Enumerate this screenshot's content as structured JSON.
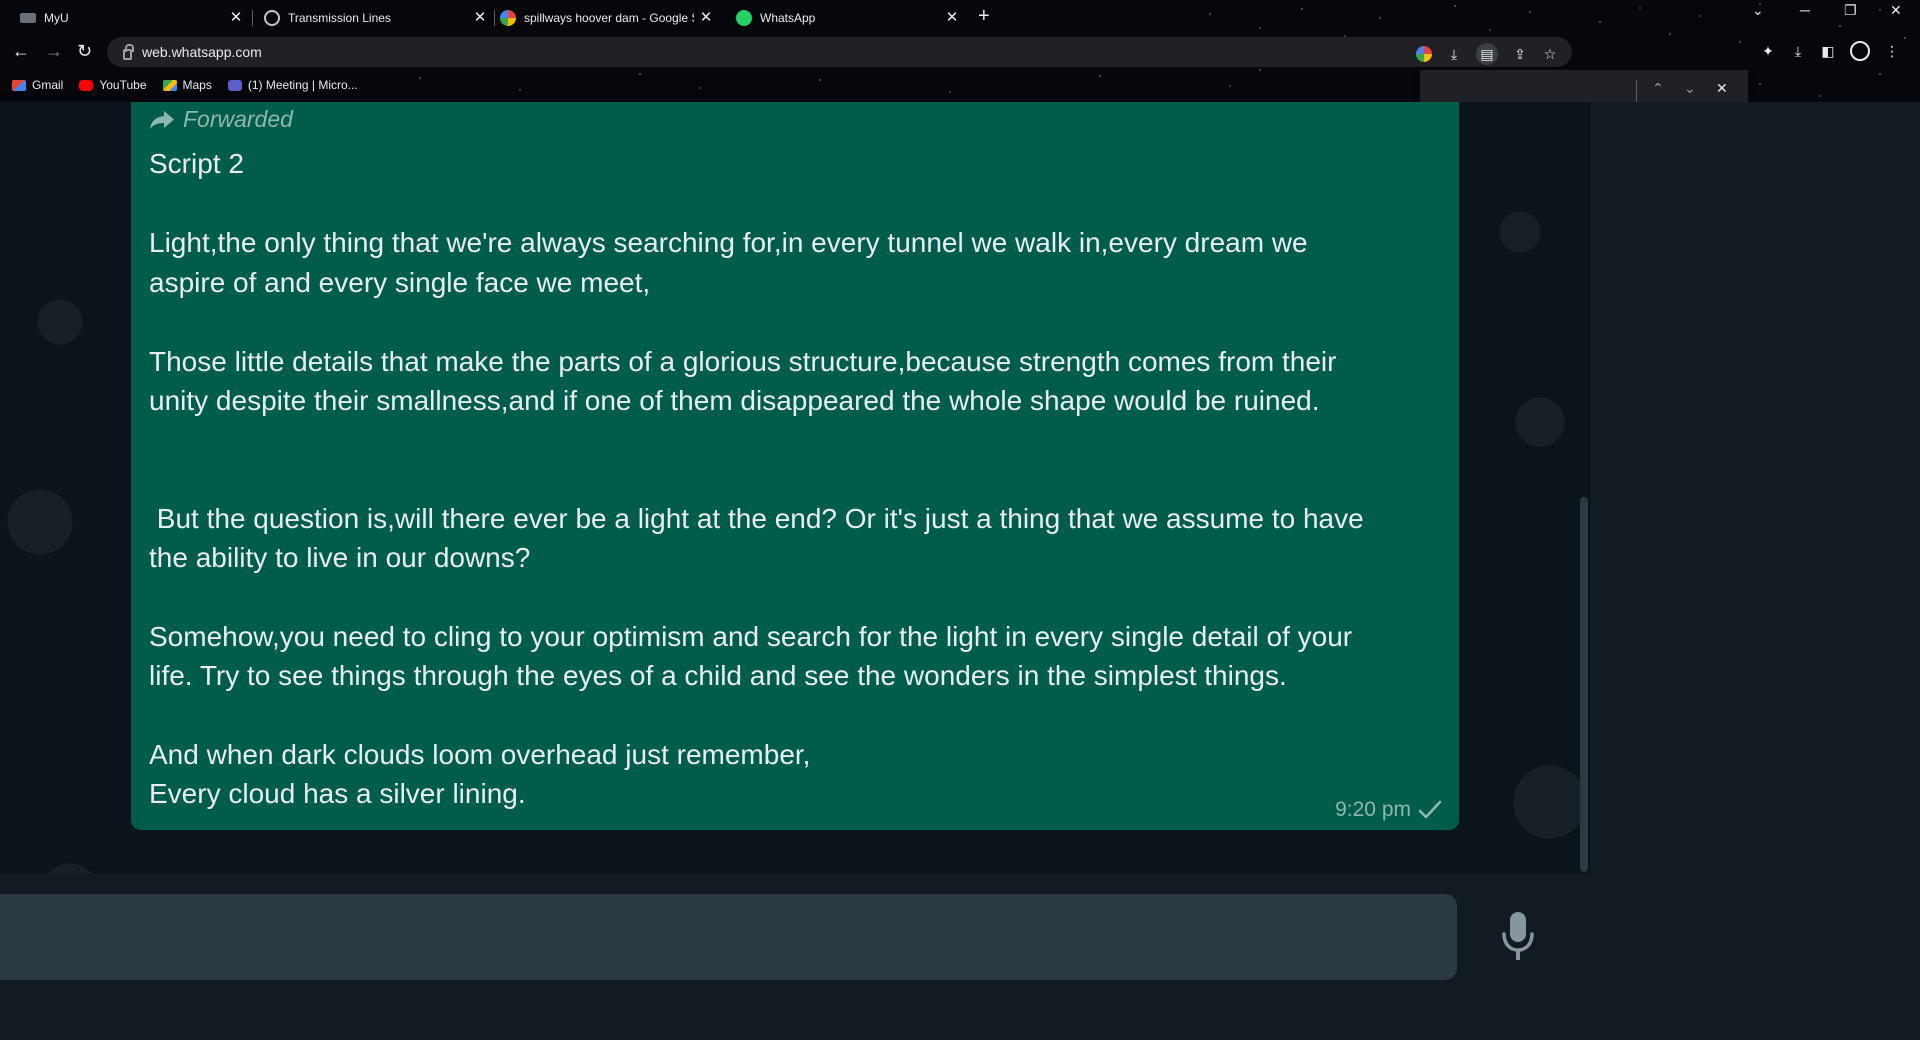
{
  "browser": {
    "tabs": [
      {
        "title": "MyU",
        "icon": "myu-favicon"
      },
      {
        "title": "Transmission Lines",
        "icon": "globe-favicon"
      },
      {
        "title": "spillways hoover dam - Google S",
        "icon": "google-favicon"
      },
      {
        "title": "WhatsApp",
        "icon": "whatsapp-favicon"
      }
    ],
    "new_tab_label": "+",
    "url": "web.whatsapp.com",
    "bookmarks": [
      {
        "label": "Gmail",
        "icon": "gmail-icon"
      },
      {
        "label": "YouTube",
        "icon": "youtube-icon"
      },
      {
        "label": "Maps",
        "icon": "maps-icon"
      },
      {
        "label": "(1) Meeting | Micro...",
        "icon": "teams-icon"
      }
    ]
  },
  "message": {
    "forwarded_label": "Forwarded",
    "lines": [
      "Script 2",
      "Light,the only thing that we're always searching for,in every tunnel we walk in,every dream we",
      "aspire of and every single face we meet,",
      "Those little details that make the parts of a glorious structure,because strength comes from their",
      "unity despite their smallness,and if one of them disappeared the whole shape would be ruined.",
      " But the question is,will there ever be a light at the end? Or it's just a thing that we assume to have",
      "the ability to live in our downs?",
      "Somehow,you need to cling to your optimism and search for the light in every single detail of your",
      "life. Try to see things through the eyes of a child and see the wonders in the simplest things.",
      "And when dark clouds loom overhead just remember,",
      "Every cloud has a silver lining."
    ],
    "time": "9:20 pm",
    "status_icon": "single-check-icon"
  },
  "colors": {
    "outgoing_bubble": "#005c4b",
    "chat_background": "#0b141a",
    "panel": "#111b21",
    "composer_input": "#2a3942"
  }
}
